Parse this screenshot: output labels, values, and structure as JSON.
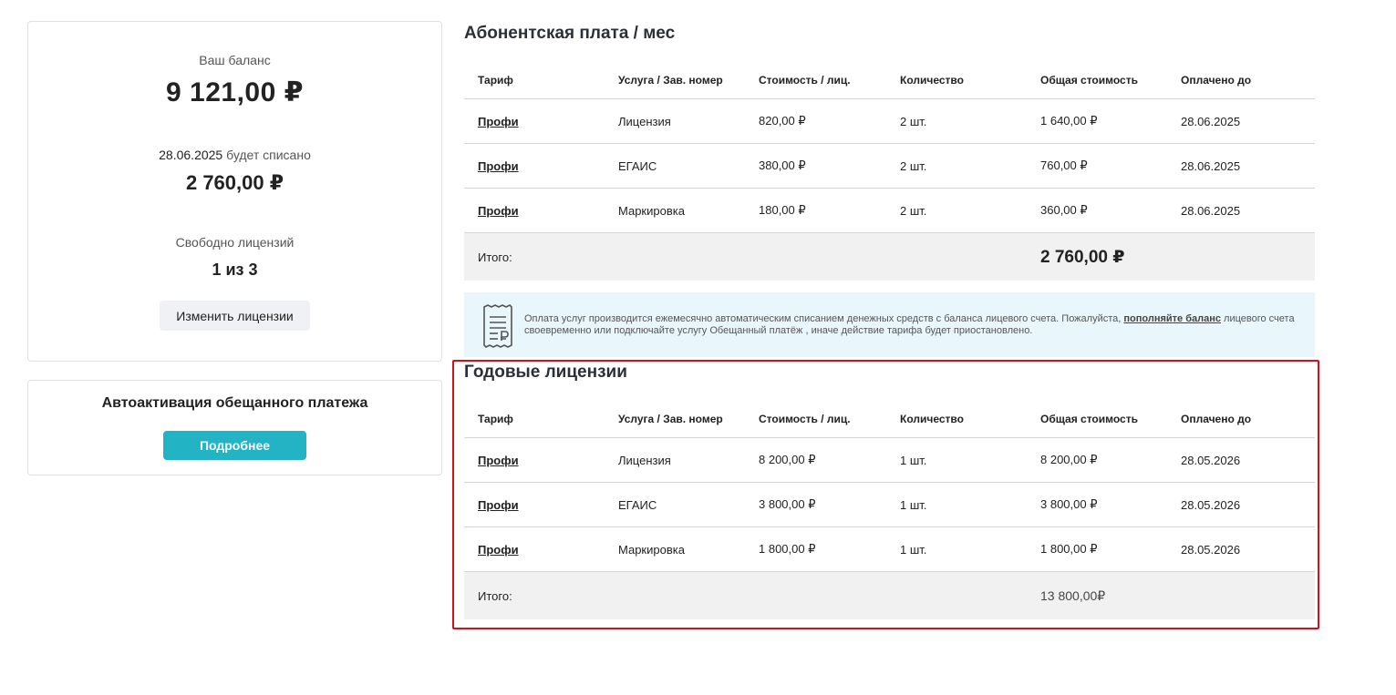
{
  "balance": {
    "label": "Ваш баланс",
    "amount": "9 121,00 ₽",
    "charge_date": "28.06.2025",
    "charge_label": "будет списано",
    "charge_amount": "2 760,00 ₽",
    "free_label": "Свободно лицензий",
    "free_value": "1 из 3",
    "change_button": "Изменить лицензии"
  },
  "auto": {
    "title": "Автоактивация обещанного платежа",
    "more_button": "Подробнее"
  },
  "monthly": {
    "title": "Абонентская плата / мес",
    "headers": [
      "Тариф",
      "Услуга / Зав. номер",
      "Стоимость / лиц.",
      "Количество",
      "Общая стоимость",
      "Оплачено до"
    ],
    "rows": [
      {
        "tariff": "Профи",
        "service": "Лицензия",
        "price": "820,00 ₽",
        "qty": "2 шт.",
        "total": "1 640,00 ₽",
        "paid": "28.06.2025"
      },
      {
        "tariff": "Профи",
        "service": "ЕГАИС",
        "price": "380,00 ₽",
        "qty": "2 шт.",
        "total": "760,00 ₽",
        "paid": "28.06.2025"
      },
      {
        "tariff": "Профи",
        "service": "Маркировка",
        "price": "180,00 ₽",
        "qty": "2 шт.",
        "total": "360,00 ₽",
        "paid": "28.06.2025"
      }
    ],
    "total_label": "Итого:",
    "total_value": "2 760,00 ₽"
  },
  "notice": {
    "text_before": "Оплата услуг производится ежемесячно автоматическим списанием денежных средств с баланса лицевого счета. Пожалуйста, ",
    "link": "пополняйте баланс",
    "text_after": " лицевого счета своевременно или подключайте услугу Обещанный платёж , иначе действие тарифа будет приостановлено.",
    "icon": "receipt-ruble-icon"
  },
  "annual": {
    "title": "Годовые лицензии",
    "headers": [
      "Тариф",
      "Услуга / Зав. номер",
      "Стоимость / лиц.",
      "Количество",
      "Общая стоимость",
      "Оплачено до"
    ],
    "rows": [
      {
        "tariff": "Профи",
        "service": "Лицензия",
        "price": "8 200,00 ₽",
        "qty": "1 шт.",
        "total": "8 200,00 ₽",
        "paid": "28.05.2026"
      },
      {
        "tariff": "Профи",
        "service": "ЕГАИС",
        "price": "3 800,00 ₽",
        "qty": "1 шт.",
        "total": "3 800,00 ₽",
        "paid": "28.05.2026"
      },
      {
        "tariff": "Профи",
        "service": "Маркировка",
        "price": "1 800,00 ₽",
        "qty": "1 шт.",
        "total": "1 800,00 ₽",
        "paid": "28.05.2026"
      }
    ],
    "total_label": "Итого:",
    "total_value": "13 800,00₽"
  },
  "colors": {
    "accent": "#22b3c4",
    "highlight": "#d0121b",
    "notice_bg": "#e9f6fc"
  }
}
